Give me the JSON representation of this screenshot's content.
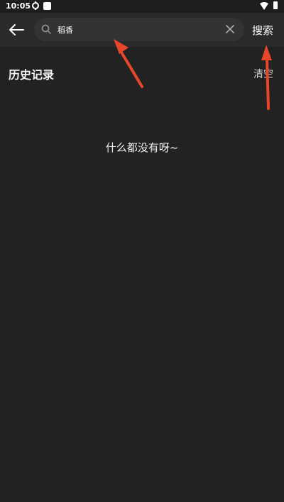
{
  "status_bar": {
    "time": "10:05",
    "icons": [
      "sync-icon",
      "square-icon",
      "wifi-icon",
      "battery-icon"
    ]
  },
  "top_bar": {
    "back_icon": "arrow-left-icon",
    "search": {
      "icon": "search-icon",
      "value": "稻香",
      "clear_icon": "close-icon"
    },
    "search_button_label": "搜索"
  },
  "history": {
    "title": "历史记录",
    "clear_label": "清空"
  },
  "empty_state": {
    "message": "什么都没有呀~"
  },
  "colors": {
    "background": "#222222",
    "top_bar": "#2a2a2a",
    "search_box": "#333333",
    "cursor": "#23c3a5",
    "annotation_arrow": "#e8462a"
  }
}
